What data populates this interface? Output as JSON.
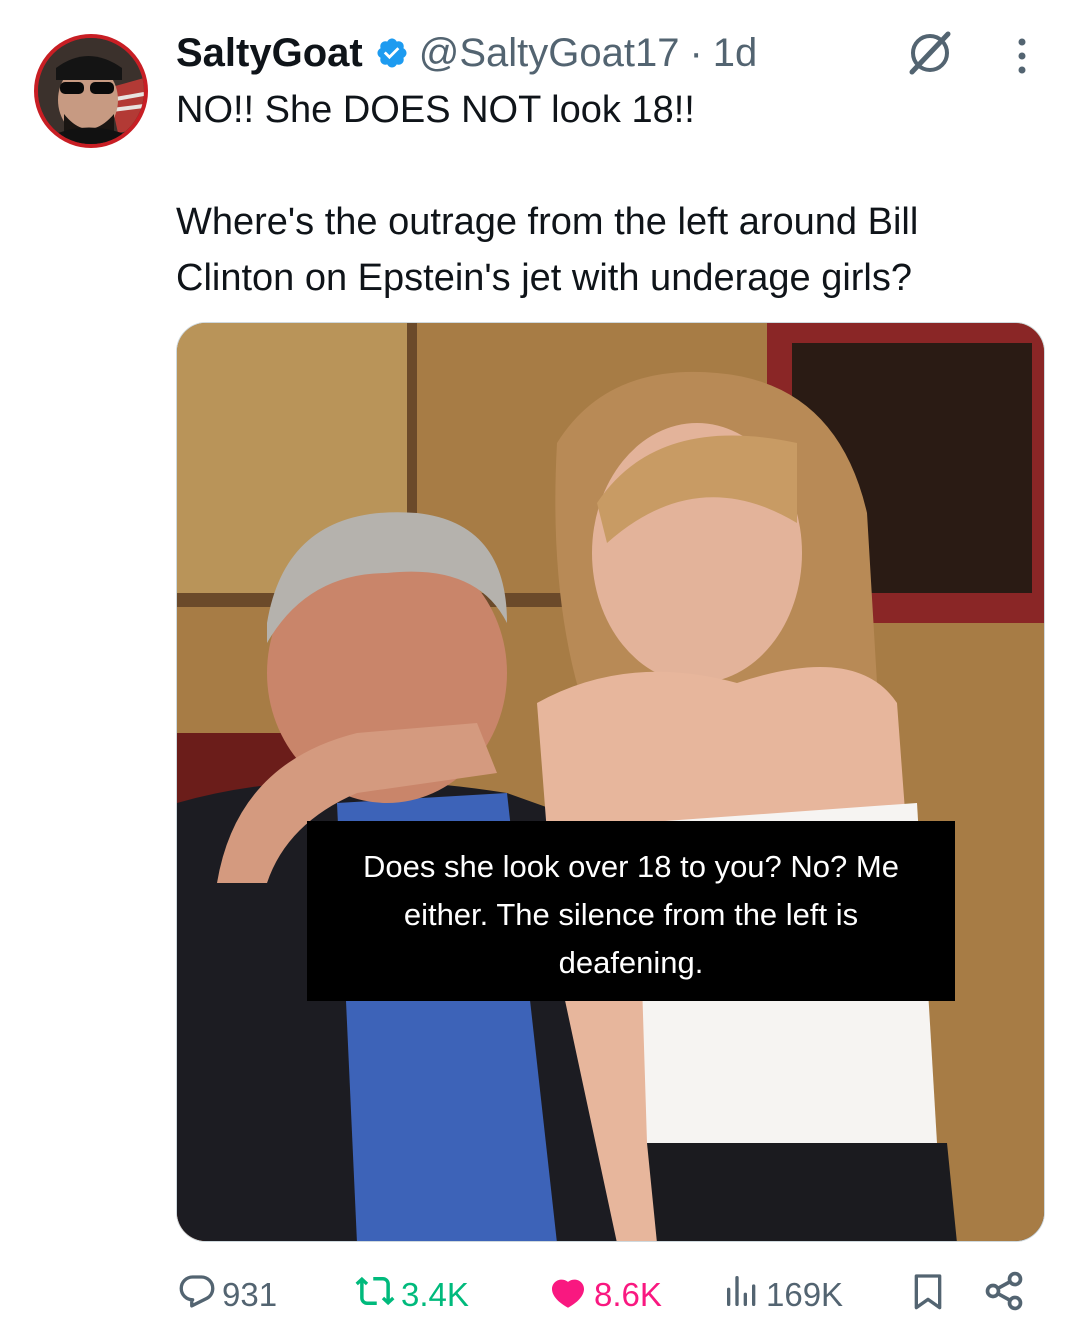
{
  "tweet": {
    "author_name": "SaltyGoat",
    "author_handle": "@SaltyGoat17",
    "separator": "·",
    "timestamp": "1d",
    "text": "NO!!  She DOES NOT look 18!!\n\nWhere's the outrage from the left around Bill Clinton on Epstein's jet with underage girls?"
  },
  "media": {
    "caption": "Does she look over 18 to you? No? Me either. The silence from the left is deafening."
  },
  "actions": {
    "reply_count": "931",
    "retweet_count": "3.4K",
    "like_count": "8.6K",
    "view_count": "169K"
  },
  "colors": {
    "verified": "#1d9bf0",
    "retweet_active": "#00ba7c",
    "like_active": "#f91880",
    "secondary_text": "#536471"
  },
  "icons": [
    "verified-badge-icon",
    "grok-icon",
    "more-icon",
    "reply-icon",
    "retweet-icon",
    "like-icon",
    "views-icon",
    "bookmark-icon",
    "share-icon"
  ]
}
